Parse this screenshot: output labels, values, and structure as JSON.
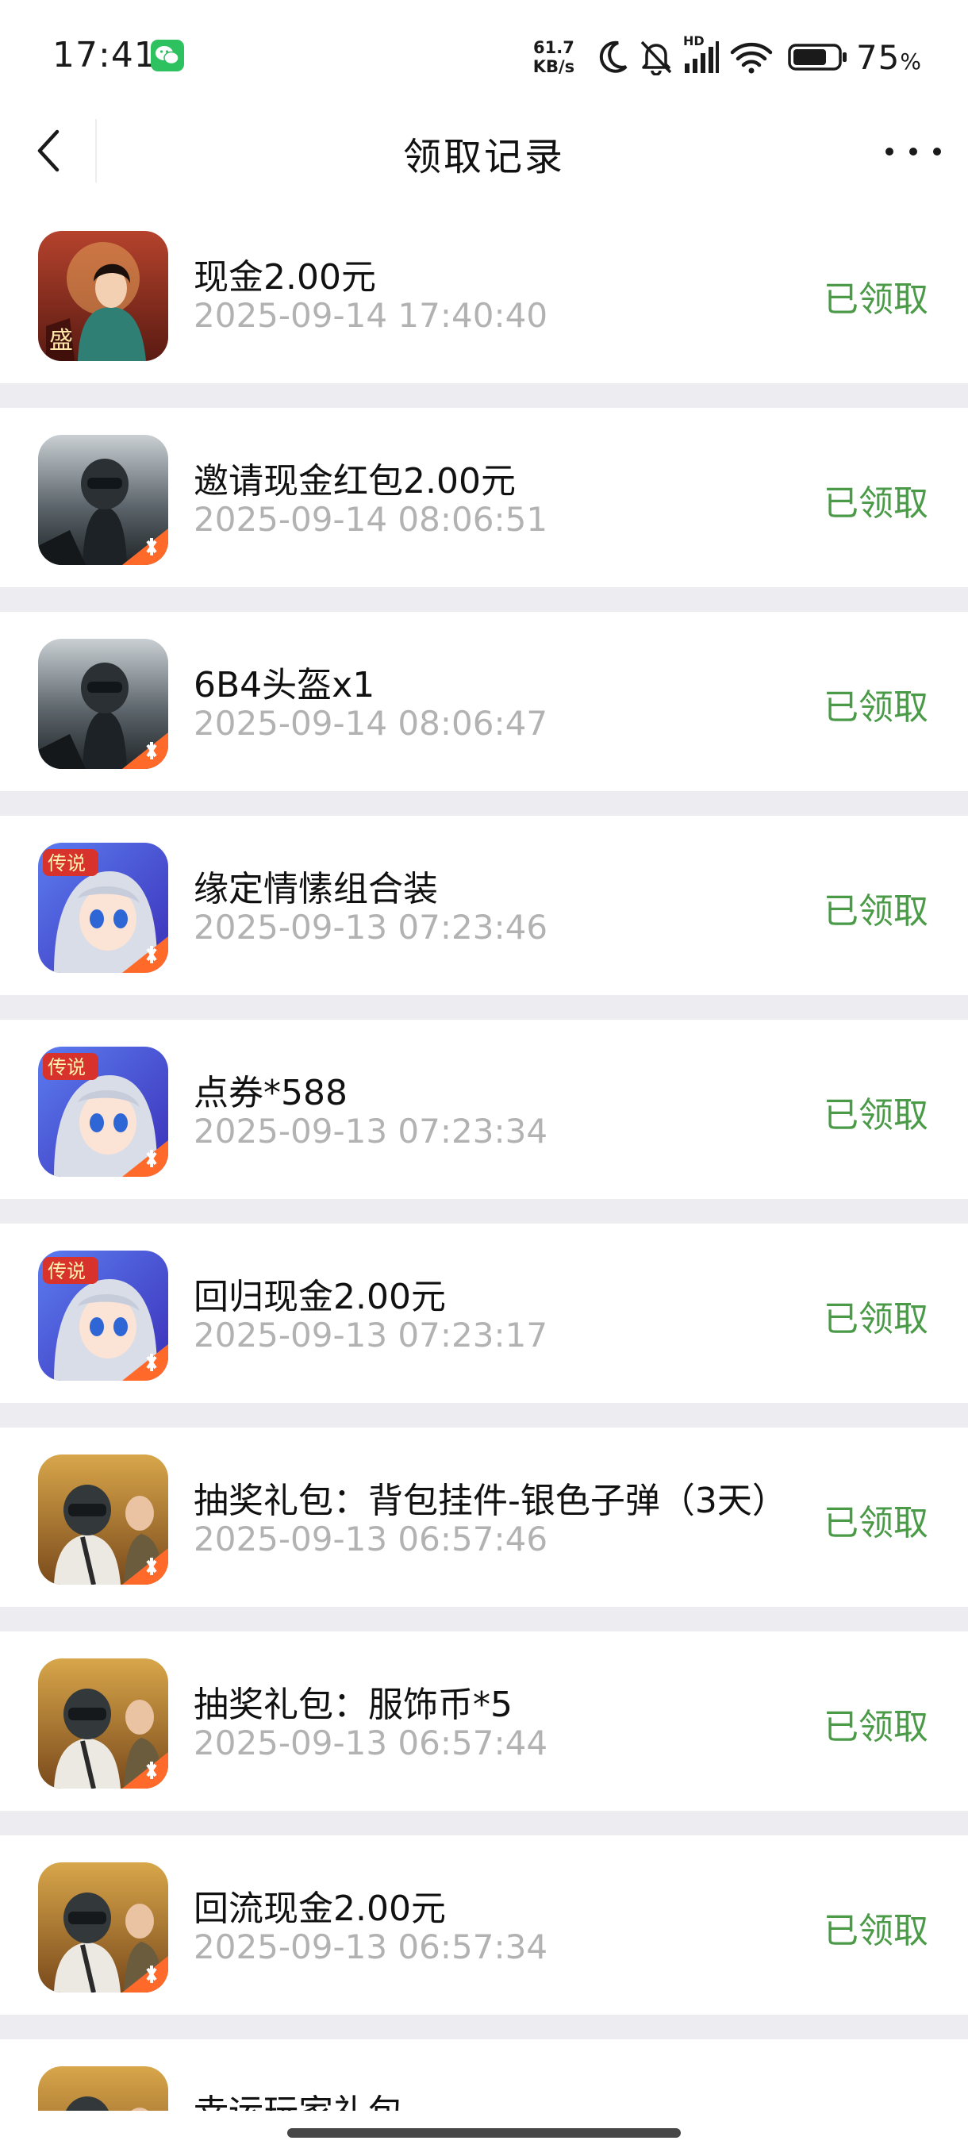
{
  "status_bar": {
    "time": "17:41",
    "net_speed_value": "61.7",
    "net_speed_unit": "KB/s",
    "network_label": "HD",
    "battery_percent": "75",
    "battery_unit": "%",
    "app_notification_icon": "wechat-icon",
    "battery_level": 0.75
  },
  "nav": {
    "title": "领取记录",
    "back_icon": "chevron-left-icon",
    "more_icon": "more-dots-icon"
  },
  "records": [
    {
      "title": "现金2.00元",
      "time": "2025-09-14 17:40:40",
      "status": "已领取",
      "game_icon": "palace-drama-game-icon"
    },
    {
      "title": "邀请现金红包2.00元",
      "time": "2025-09-14 08:06:51",
      "status": "已领取",
      "game_icon": "tactical-shooter-game-icon"
    },
    {
      "title": "6B4头盔x1",
      "time": "2025-09-14 08:06:47",
      "status": "已领取",
      "game_icon": "tactical-shooter-game-icon"
    },
    {
      "title": "缘定情愫组合装",
      "time": "2025-09-13 07:23:46",
      "status": "已领取",
      "game_icon": "anime-girl-game-icon"
    },
    {
      "title": "点券*588",
      "time": "2025-09-13 07:23:34",
      "status": "已领取",
      "game_icon": "anime-girl-game-icon"
    },
    {
      "title": "回归现金2.00元",
      "time": "2025-09-13 07:23:17",
      "status": "已领取",
      "game_icon": "anime-girl-game-icon"
    },
    {
      "title": "抽奖礼包：背包挂件-银色子弹（3天）",
      "time": "2025-09-13 06:57:46",
      "status": "已领取",
      "game_icon": "battle-royale-game-icon"
    },
    {
      "title": "抽奖礼包：服饰币*5",
      "time": "2025-09-13 06:57:44",
      "status": "已领取",
      "game_icon": "battle-royale-game-icon"
    },
    {
      "title": "回流现金2.00元",
      "time": "2025-09-13 06:57:34",
      "status": "已领取",
      "game_icon": "battle-royale-game-icon"
    },
    {
      "title": "幸运玩家礼包",
      "time": "",
      "status": "",
      "game_icon": "battle-royale-game-icon"
    }
  ],
  "colors": {
    "status_green": "#4a9a48",
    "timestamp_gray": "#b2b2b2",
    "list_background": "#ededf1",
    "wechat_green": "#2dc15f"
  }
}
